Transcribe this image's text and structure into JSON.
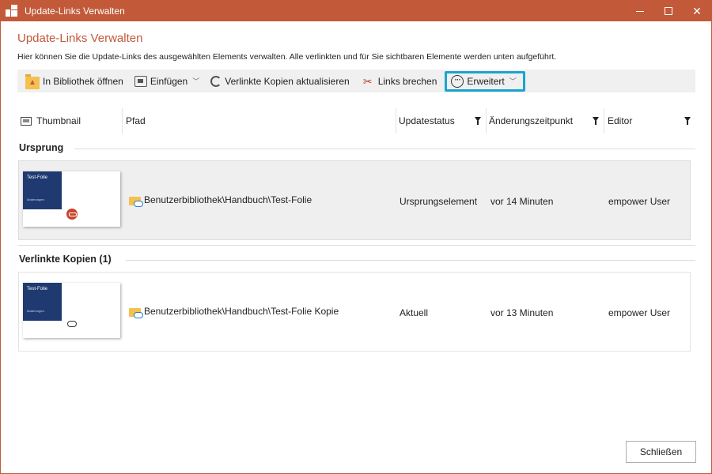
{
  "window": {
    "title": "Update-Links Verwalten",
    "accent_color": "#c25a3a",
    "controls": [
      "minimize-icon",
      "maximize-icon",
      "close-icon"
    ]
  },
  "header": {
    "title": "Update-Links Verwalten",
    "description": "Hier können Sie die Update-Links des ausgewählten Elements verwalten. Alle verlinkten und für Sie sichtbaren Elemente werden unten aufgeführt."
  },
  "toolbar": {
    "open_library": "In Bibliothek öffnen",
    "insert": "Einfügen",
    "update_copies": "Verlinkte Kopien aktualisieren",
    "break_links": "Links brechen",
    "advanced": "Erweitert",
    "highlight_color": "#1aa3d1"
  },
  "columns": {
    "thumbnail": "Thumbnail",
    "path": "Pfad",
    "status": "Updatestatus",
    "changed": "Änderungszeitpunkt",
    "editor": "Editor"
  },
  "groups": {
    "origin": {
      "title": "Ursprung",
      "row": {
        "slide_title": "Test-Folie",
        "slide_subtitle": "Änderungen",
        "path": "Benutzerbibliothek\\Handbuch\\Test-Folie",
        "status": "Ursprungselement",
        "changed": "vor 14 Minuten",
        "editor": "empower User"
      }
    },
    "copies": {
      "title": "Verlinkte Kopien (1)",
      "row": {
        "slide_title": "Test-Folie",
        "slide_subtitle": "Änderungen",
        "path": "Benutzerbibliothek\\Handbuch\\Test-Folie Kopie",
        "status": "Aktuell",
        "changed": "vor 13 Minuten",
        "editor": "empower User"
      }
    }
  },
  "footer": {
    "close": "Schließen"
  }
}
